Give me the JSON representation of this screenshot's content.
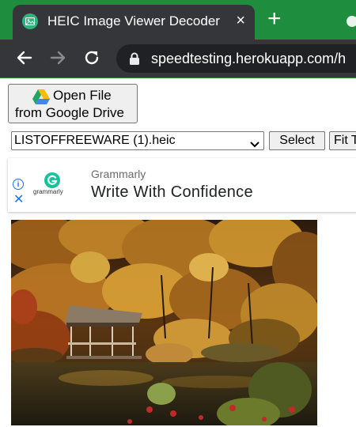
{
  "browser": {
    "tab_title": "HEIC Image Viewer Decoder",
    "tab_close": "×",
    "new_tab": "+",
    "url": "speedtesting.herokuapp.com/h",
    "colors": {
      "theme": "#1e8e3e",
      "toolbar": "#35363a",
      "omnibox": "#202124"
    }
  },
  "page": {
    "gdrive_button": {
      "line1": "Open File",
      "line2": "from Google Drive"
    },
    "file_select": {
      "value": "LISTOFFREEWARE (1).heic"
    },
    "select_button": "Select",
    "fit_button": "Fit T",
    "ad": {
      "brand": "Grammarly",
      "headline": "Write With Confidence",
      "logo_text": "grammarly",
      "info_icon": "i",
      "close_icon": "✕"
    },
    "image": {
      "description_icon": "autumn-lake-gazebo-photo"
    }
  }
}
